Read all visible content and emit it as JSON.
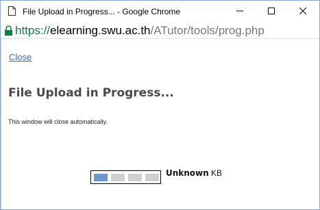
{
  "window": {
    "title": "File Upload in Progress... - Google Chrome",
    "controls": {
      "minimize_icon": "minimize-icon",
      "maximize_icon": "maximize-icon",
      "close_icon": "close-icon"
    }
  },
  "address": {
    "protocol": "https://",
    "host": "elearning.swu.ac.th",
    "path": "/ATutor/tools/prog.php",
    "secure_color": "#0b8043"
  },
  "page": {
    "close_link": "Close",
    "heading": "File Upload in Progress...",
    "note": "This window will close automatically.",
    "progress": {
      "segments_total": 4,
      "segments_active": 1,
      "active_color": "#6b99c9",
      "inactive_color": "#d0d0d0"
    },
    "size_value": "Unknown",
    "size_unit": " KB"
  }
}
